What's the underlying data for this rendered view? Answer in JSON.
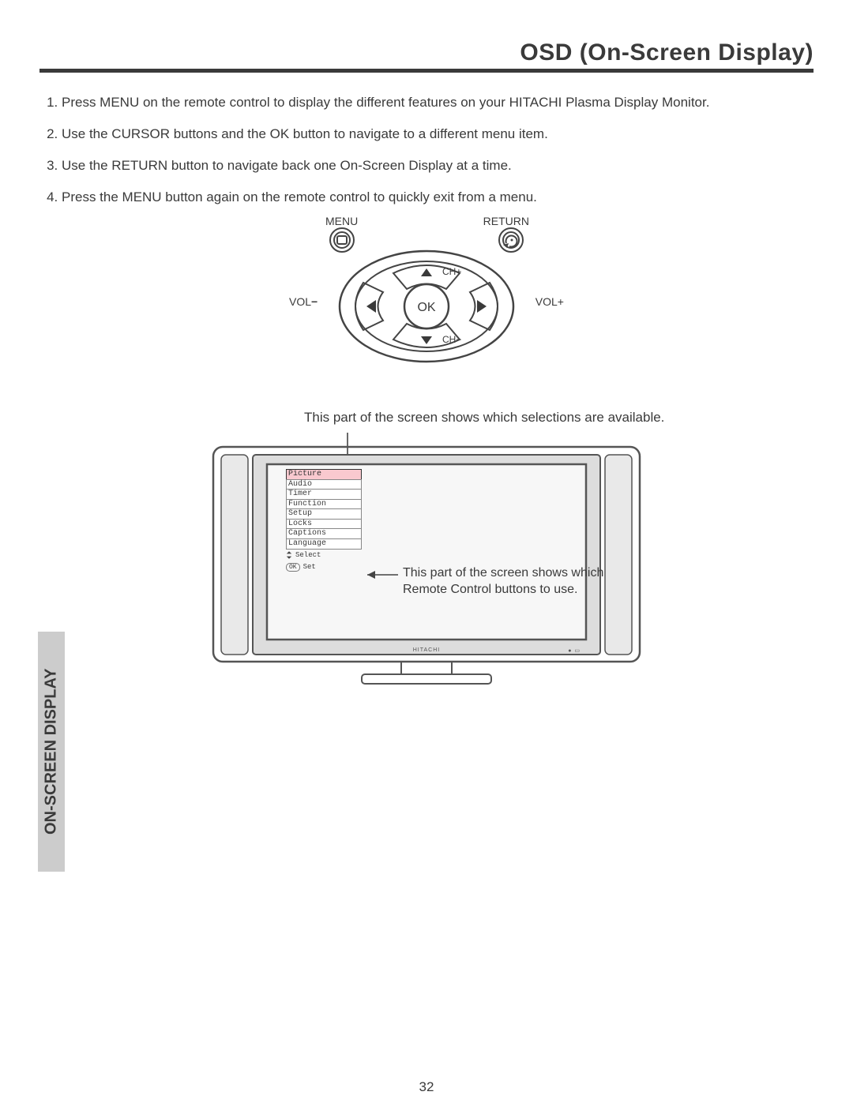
{
  "title": "OSD (On-Screen Display)",
  "steps": [
    "Press MENU on the remote control to display the different features on your HITACHI Plasma Display Monitor.",
    "Use the CURSOR buttons and the OK button to navigate to a different menu item.",
    "Use the RETURN button to navigate back one On-Screen Display at a time.",
    "Press the MENU button again on the remote control to quickly exit from a menu."
  ],
  "remote": {
    "menu": "MENU",
    "return": "RETURN",
    "vol_minus": "VOL",
    "vol_plus": "VOL+",
    "ch_plus": "CH+",
    "ch_minus": "CH",
    "ok": "OK"
  },
  "caption_top": "This part of the screen shows which selections are available.",
  "caption_right": "This part of the screen shows which Remote Control buttons to use.",
  "osd": {
    "items": [
      "Picture",
      "Audio",
      "Timer",
      "Function",
      "Setup",
      "Locks",
      "Captions",
      "Language"
    ],
    "select_label": "Select",
    "ok_label": "OK",
    "set_label": "Set"
  },
  "tv_brand": "HITACHI",
  "side_tab": "ON-SCREEN DISPLAY",
  "page_number": "32"
}
